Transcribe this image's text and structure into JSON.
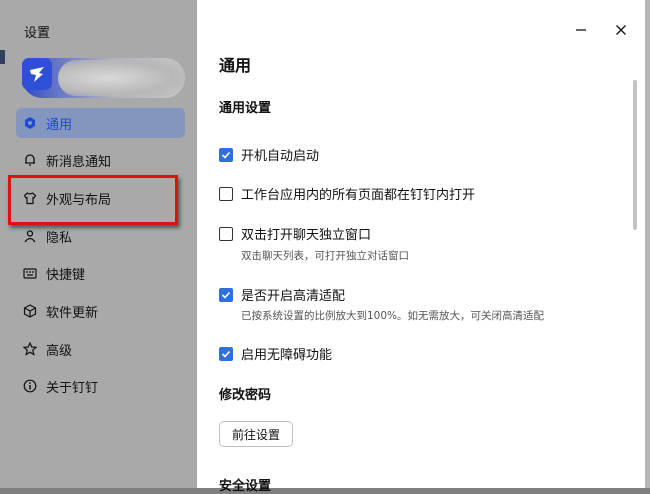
{
  "window": {
    "title": "设置"
  },
  "sidebar": {
    "items": [
      {
        "label": "通用",
        "icon": "general-icon",
        "active": true
      },
      {
        "label": "新消息通知",
        "icon": "bell-icon"
      },
      {
        "label": "外观与布局",
        "icon": "shirt-icon"
      },
      {
        "label": "隐私",
        "icon": "user-icon"
      },
      {
        "label": "快捷键",
        "icon": "keyboard-icon"
      },
      {
        "label": "软件更新",
        "icon": "cube-icon"
      },
      {
        "label": "高级",
        "icon": "star-icon"
      },
      {
        "label": "关于钉钉",
        "icon": "info-icon"
      }
    ]
  },
  "main": {
    "title": "通用",
    "general_settings": "通用设置",
    "options": [
      {
        "label": "开机自动启动",
        "checked": true
      },
      {
        "label": "工作台应用内的所有页面都在钉钉内打开",
        "checked": false
      },
      {
        "label": "双击打开聊天独立窗口",
        "checked": false,
        "description": "双击聊天列表，可打开独立对话窗口"
      },
      {
        "label": "是否开启高清适配",
        "checked": true,
        "description": "已按系统设置的比例放大到100%。如无需放大，可关闭高清适配"
      },
      {
        "label": "启用无障碍功能",
        "checked": true
      }
    ],
    "password_section": "修改密码",
    "password_button": "前往设置",
    "security_section": "安全设置"
  },
  "colors": {
    "accent": "#2f6fe0",
    "highlight_border": "#e01010",
    "sidebar_bg": "#a9a9a9",
    "active_item_bg": "#8296c0"
  }
}
